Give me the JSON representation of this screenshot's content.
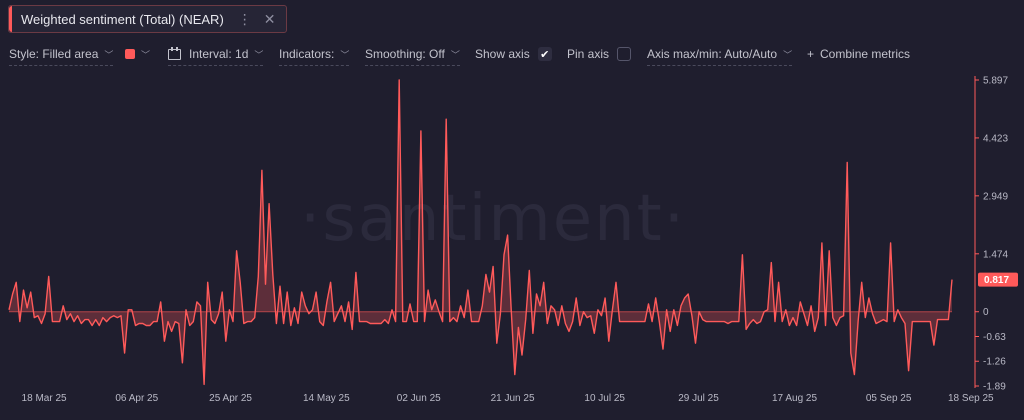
{
  "metric": {
    "title": "Weighted sentiment (Total) (NEAR)",
    "menu_icon": "more-vertical-icon",
    "close_icon": "close-icon",
    "accent_color": "#ff5a5a"
  },
  "toolbar": {
    "style_label": "Style: Filled area",
    "color_swatch": "#ff5a5a",
    "interval_label": "Interval: 1d",
    "indicators_label": "Indicators:",
    "smoothing_label": "Smoothing: Off",
    "show_axis_label": "Show axis",
    "show_axis_checked": true,
    "pin_axis_label": "Pin axis",
    "pin_axis_checked": false,
    "axis_maxmin_label": "Axis max/min: Auto/Auto",
    "combine_label": "Combine metrics"
  },
  "watermark": "·santiment·",
  "current_value": "0.817",
  "chart_data": {
    "type": "area",
    "title": "Weighted sentiment (Total) (NEAR)",
    "y_ticks": [
      "5.897",
      "4.423",
      "2.949",
      "1.474",
      "0",
      "-0.63",
      "-1.26",
      "-1.89"
    ],
    "y_tick_values": [
      5.897,
      4.423,
      2.949,
      1.474,
      0,
      -0.63,
      -1.26,
      -1.89
    ],
    "ylim": [
      -1.89,
      5.897
    ],
    "x_ticks": [
      "18 Mar 25",
      "06 Apr 25",
      "25 Apr 25",
      "14 May 25",
      "02 Jun 25",
      "21 Jun 25",
      "10 Jul 25",
      "29 Jul 25",
      "17 Aug 25",
      "05 Sep 25",
      "18 Sep 25"
    ],
    "x_start": "11 Mar 25",
    "x_end": "18 Sep 25",
    "grid": false,
    "series": [
      {
        "values": [
          0.05,
          0.45,
          0.75,
          -0.25,
          0.55,
          0.1,
          0.5,
          -0.15,
          -0.1,
          -0.3,
          -0.05,
          0.9,
          -0.25,
          -0.25,
          -0.25,
          0.15,
          -0.2,
          -0.05,
          -0.25,
          -0.1,
          -0.3,
          -0.2,
          -0.2,
          -0.35,
          -0.2,
          -0.35,
          -0.15,
          -0.25,
          -0.15,
          -0.1,
          -0.15,
          -0.1,
          -1.05,
          0.05,
          0.05,
          -0.35,
          -0.3,
          -0.3,
          -0.35,
          -0.35,
          -0.25,
          -0.25,
          0.25,
          -0.75,
          -0.25,
          -0.5,
          -0.25,
          -0.3,
          -1.3,
          0.05,
          -0.35,
          -0.25,
          0.25,
          0.15,
          -1.85,
          0.75,
          -0.2,
          -0.3,
          -0.05,
          0.5,
          -0.75,
          0.05,
          -0.25,
          1.55,
          0.75,
          -0.3,
          -0.25,
          -0.25,
          -0.15,
          0.9,
          3.6,
          0.7,
          2.75,
          0.95,
          -0.3,
          0.65,
          -0.3,
          0.5,
          -0.35,
          0.1,
          -0.3,
          0.5,
          0.15,
          -0.05,
          0.05,
          0.5,
          -0.25,
          -0.35,
          0.25,
          0.75,
          -0.25,
          -0.05,
          0.15,
          -0.25,
          0.25,
          -0.45,
          1.0,
          -0.25,
          -0.25,
          -0.25,
          -0.3,
          -0.3,
          -0.3,
          -0.3,
          -0.2,
          -0.3,
          0.05,
          -0.25,
          5.897,
          -0.25,
          -0.25,
          0.2,
          -0.25,
          -0.25,
          4.6,
          -0.25,
          0.55,
          0.05,
          0.3,
          0.0,
          -0.25,
          4.9,
          -0.25,
          -0.15,
          -0.25,
          0.15,
          -0.15,
          0.55,
          -0.25,
          -0.25,
          -0.25,
          0.15,
          0.95,
          0.5,
          1.15,
          -0.8,
          -0.05,
          1.45,
          1.95,
          0.05,
          -1.6,
          -0.4,
          -1.1,
          -0.2,
          1.05,
          -0.55,
          0.45,
          0.15,
          0.75,
          -0.3,
          0.15,
          0.05,
          -0.35,
          0.15,
          -0.3,
          -0.5,
          -0.25,
          0.35,
          -0.35,
          0.0,
          -0.15,
          -0.1,
          -0.55,
          0.05,
          -0.1,
          0.35,
          -0.75,
          0.05,
          0.75,
          -0.25,
          -0.25,
          -0.25,
          -0.25,
          -0.25,
          -0.25,
          -0.25,
          -0.25,
          0.2,
          -0.25,
          0.35,
          -0.25,
          -0.95,
          0.05,
          -0.5,
          0.05,
          -0.35,
          0.15,
          0.35,
          0.45,
          -0.1,
          -0.8,
          0.0,
          -0.2,
          -0.25,
          -0.25,
          -0.25,
          -0.25,
          -0.25,
          -0.25,
          -0.3,
          -0.25,
          -0.25,
          -0.25,
          1.45,
          -0.45,
          -0.3,
          -0.2,
          -0.3,
          -0.25,
          0.0,
          0.05,
          1.25,
          -0.25,
          0.75,
          -0.25,
          0.05,
          -0.35,
          -0.15,
          -0.35,
          0.25,
          -0.05,
          -0.35,
          0.15,
          -0.5,
          -0.15,
          1.75,
          -0.35,
          1.55,
          -0.15,
          -0.35,
          -0.15,
          -0.1,
          3.8,
          -1.05,
          -1.6,
          -0.25,
          0.75,
          -0.15,
          0.35,
          -0.05,
          -0.3,
          -0.25,
          -0.2,
          -0.25,
          1.75,
          -0.25,
          0.05,
          -0.15,
          -0.3,
          -1.5,
          -0.25,
          -0.25,
          -0.25,
          -0.25,
          -0.25,
          -0.25,
          -0.85,
          -0.2,
          -0.2,
          -0.2,
          -0.2,
          0.817
        ]
      }
    ]
  }
}
